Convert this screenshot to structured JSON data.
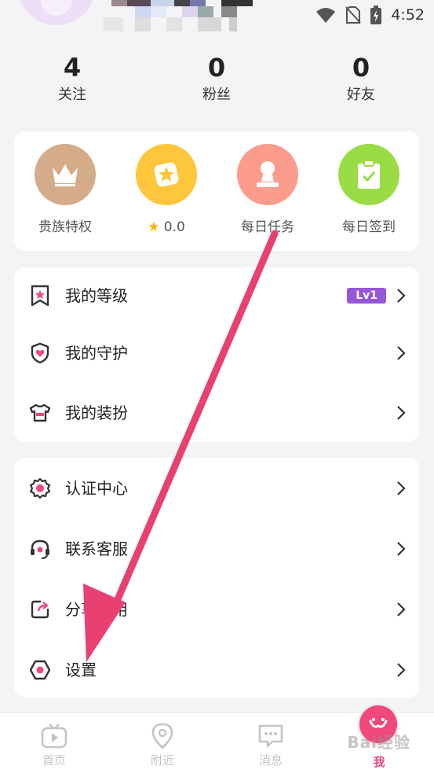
{
  "status_bar": {
    "time": "4:52"
  },
  "stats": [
    {
      "value": "4",
      "label": "关注"
    },
    {
      "value": "0",
      "label": "粉丝"
    },
    {
      "value": "0",
      "label": "好友"
    }
  ],
  "quick_actions": [
    {
      "label": "贵族特权",
      "icon": "crown-icon",
      "color": "#d4ac8a"
    },
    {
      "label": "0.0",
      "icon": "star-badge-icon",
      "color": "#fdc63b"
    },
    {
      "label": "每日任务",
      "icon": "person-stamp-icon",
      "color": "#fb9c8c"
    },
    {
      "label": "每日签到",
      "icon": "clipboard-check-icon",
      "color": "#99dc45"
    }
  ],
  "list_group_1": [
    {
      "label": "我的等级",
      "icon": "bookmark-star-icon",
      "badge": "Lv1"
    },
    {
      "label": "我的守护",
      "icon": "shield-heart-icon"
    },
    {
      "label": "我的装扮",
      "icon": "shirt-icon"
    }
  ],
  "list_group_2": [
    {
      "label": "认证中心",
      "icon": "certified-seal-icon"
    },
    {
      "label": "联系客服",
      "icon": "headset-icon"
    },
    {
      "label": "分享应用",
      "icon": "share-icon"
    },
    {
      "label": "设置",
      "icon": "settings-hexagon-icon"
    }
  ],
  "tabbar": [
    {
      "label": "首页",
      "icon": "tv-play-icon"
    },
    {
      "label": "附近",
      "icon": "location-pin-icon"
    },
    {
      "label": "消息",
      "icon": "chat-bubble-icon"
    },
    {
      "label": "我",
      "icon": "me-face-icon",
      "active": true
    }
  ],
  "watermark": "Bai经验",
  "colors": {
    "accent": "#f0487b",
    "badge": "#9656d6",
    "annotation_arrow": "#e84070"
  }
}
